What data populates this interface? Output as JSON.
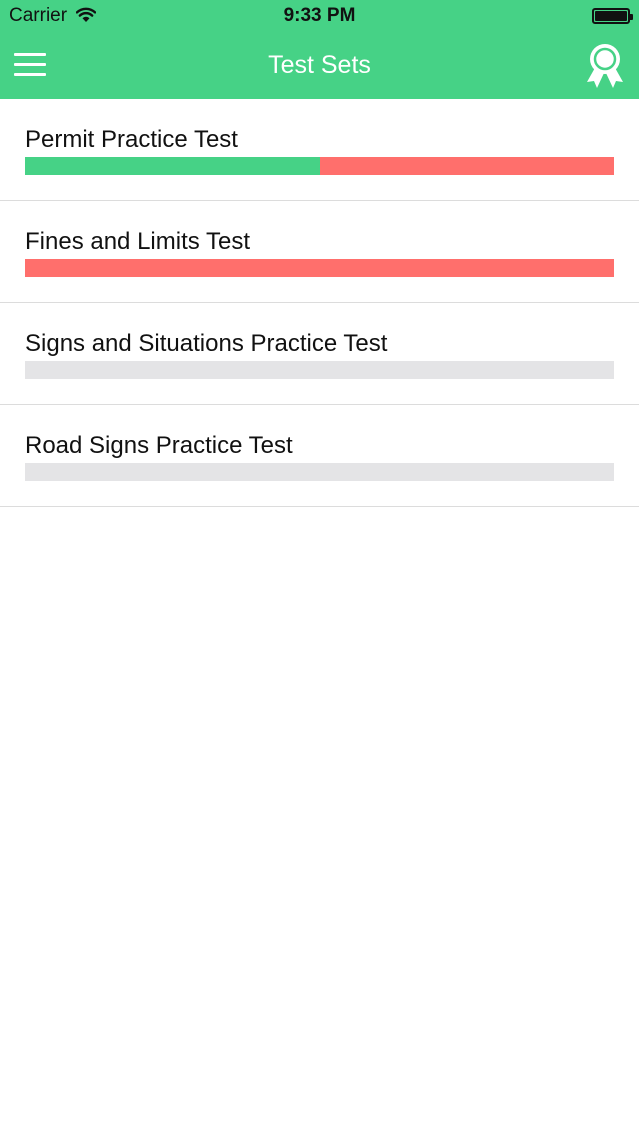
{
  "status_bar": {
    "carrier": "Carrier",
    "time": "9:33 PM"
  },
  "nav": {
    "title": "Test Sets",
    "menu_icon": "hamburger-menu-icon",
    "award_icon": "award-ribbon-icon"
  },
  "colors": {
    "brand": "#46d286",
    "correct": "#46d286",
    "incorrect": "#ff6f6c",
    "unanswered": "#e4e4e6"
  },
  "test_sets": [
    {
      "title": "Permit Practice Test",
      "progress": {
        "correct": 0.5,
        "incorrect": 0.5
      }
    },
    {
      "title": "Fines and Limits Test",
      "progress": {
        "correct": 0.0,
        "incorrect": 1.0
      }
    },
    {
      "title": "Signs and Situations Practice Test",
      "progress": {
        "correct": 0.0,
        "incorrect": 0.0
      }
    },
    {
      "title": "Road Signs Practice Test",
      "progress": {
        "correct": 0.0,
        "incorrect": 0.0
      }
    }
  ]
}
